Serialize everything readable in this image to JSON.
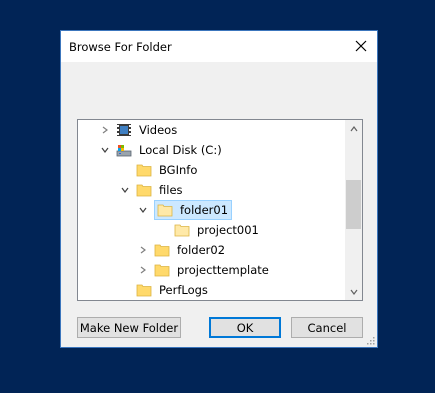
{
  "dialog": {
    "title": "Browse For Folder",
    "close_icon": "close-icon"
  },
  "tree": {
    "items": [
      {
        "label": "Videos",
        "icon": "videos-icon",
        "expander": "collapsed"
      },
      {
        "label": "Local Disk (C:)",
        "icon": "drive-icon",
        "expander": "expanded"
      },
      {
        "label": "BGInfo",
        "icon": "folder-icon",
        "expander": "none"
      },
      {
        "label": "files",
        "icon": "folder-icon",
        "expander": "expanded"
      },
      {
        "label": "folder01",
        "icon": "folder-open-icon",
        "expander": "expanded",
        "selected": true
      },
      {
        "label": "project001",
        "icon": "folder-icon",
        "expander": "none"
      },
      {
        "label": "folder02",
        "icon": "folder-icon",
        "expander": "collapsed"
      },
      {
        "label": "projecttemplate",
        "icon": "folder-icon",
        "expander": "collapsed"
      },
      {
        "label": "PerfLogs",
        "icon": "folder-icon",
        "expander": "none"
      }
    ]
  },
  "buttons": {
    "make_new_folder": "Make New Folder",
    "ok": "OK",
    "cancel": "Cancel"
  },
  "colors": {
    "desktop": "#012456",
    "selection": "#cce8ff",
    "folder": "#ffd96b",
    "accent": "#0078d7"
  }
}
